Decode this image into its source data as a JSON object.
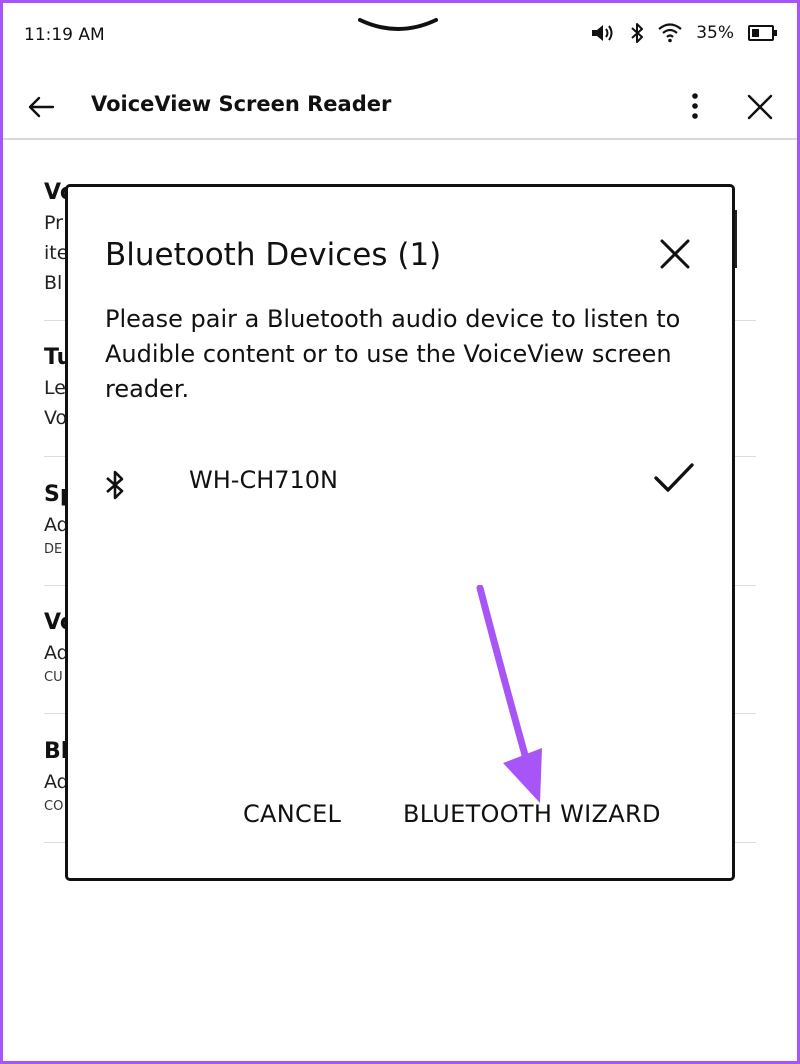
{
  "status_bar": {
    "time": "11:19 AM",
    "battery": "35%",
    "icons": [
      "volume-icon",
      "bluetooth-icon",
      "wifi-icon",
      "battery-icon"
    ]
  },
  "header": {
    "title": "VoiceView Screen Reader",
    "icons": [
      "back-arrow-icon",
      "more-options-icon",
      "close-icon"
    ]
  },
  "settings_list": {
    "items": [
      {
        "title": "Vo",
        "desc_lines": [
          "Pr",
          "ite",
          "Bl"
        ]
      },
      {
        "title": "Tu",
        "desc_lines": [
          "Le",
          "Vo"
        ]
      },
      {
        "title": "Sp",
        "desc_lines": [
          "Ad"
        ],
        "sub": "DE"
      },
      {
        "title": "Vo",
        "desc_lines": [
          "Ad"
        ],
        "sub": "CU"
      },
      {
        "title": "Bl",
        "desc_lines": [
          "Ad"
        ],
        "sub": "CO"
      }
    ]
  },
  "dialog": {
    "title": "Bluetooth Devices (1)",
    "message": "Please pair a Bluetooth audio device to listen to Audible content or to use the VoiceView screen reader.",
    "devices": [
      {
        "name": "WH-CH710N",
        "connected": true,
        "icon": "bluetooth-icon",
        "status_icon": "checkmark-icon"
      }
    ],
    "cancel_label": "CANCEL",
    "wizard_label": "BLUETOOTH WIZARD"
  },
  "colors": {
    "annotation_arrow": "#a855f7",
    "frame_border": "#a855f7",
    "divider": "#dcdcdc"
  }
}
